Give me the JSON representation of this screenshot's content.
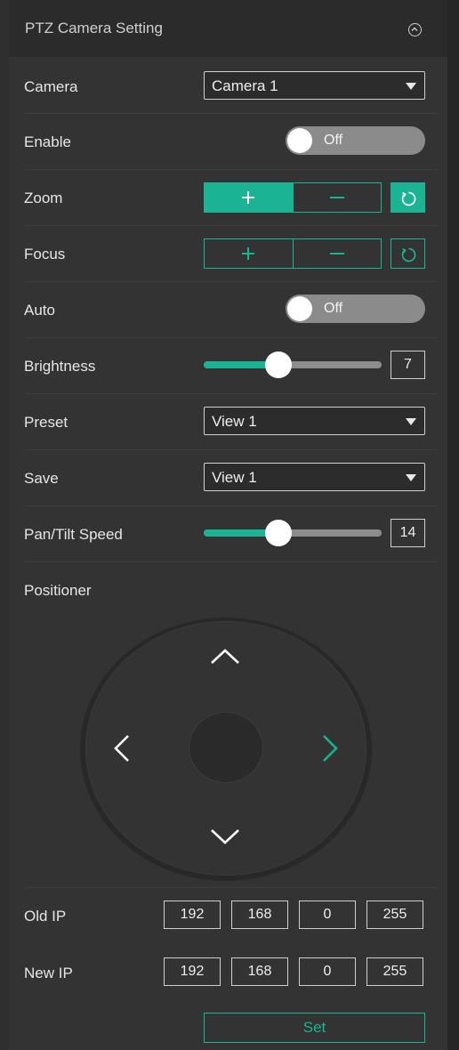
{
  "panel": {
    "title": "PTZ Camera Setting"
  },
  "camera": {
    "label": "Camera",
    "value": "Camera 1"
  },
  "enable": {
    "label": "Enable",
    "state": "Off"
  },
  "zoom": {
    "label": "Zoom"
  },
  "focus": {
    "label": "Focus"
  },
  "auto": {
    "label": "Auto",
    "state": "Off"
  },
  "brightness": {
    "label": "Brightness",
    "value": "7"
  },
  "preset": {
    "label": "Preset",
    "value": "View 1"
  },
  "save": {
    "label": "Save",
    "value": "View 1"
  },
  "pan_tilt_speed": {
    "label": "Pan/Tilt Speed",
    "value": "14"
  },
  "positioner": {
    "label": "Positioner"
  },
  "old_ip": {
    "label": "Old IP",
    "octets": [
      "192",
      "168",
      "0",
      "255"
    ]
  },
  "new_ip": {
    "label": "New IP",
    "octets": [
      "192",
      "168",
      "0",
      "255"
    ]
  },
  "set_button": {
    "label": "Set"
  },
  "colors": {
    "accent": "#1ab394",
    "background": "#333333",
    "header": "#2b2b2b",
    "toggle_off": "#8b8b8b"
  }
}
